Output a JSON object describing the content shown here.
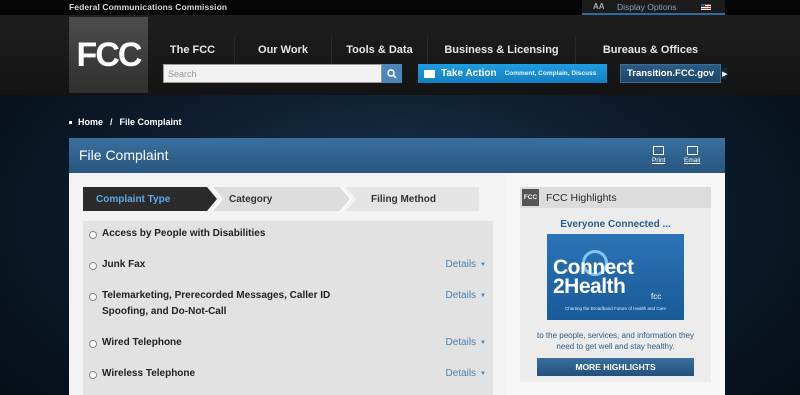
{
  "topbar": {
    "agency": "Federal Communications Commission",
    "aa": "AA",
    "display_options": "Display Options"
  },
  "logo": {
    "text": "FCC"
  },
  "nav": {
    "items": [
      {
        "label": "The FCC"
      },
      {
        "label": "Our Work"
      },
      {
        "label": "Tools & Data"
      },
      {
        "label": "Business & Licensing"
      },
      {
        "label": "Bureaus & Offices"
      }
    ]
  },
  "search": {
    "placeholder": "Search"
  },
  "take_action": {
    "label": "Take Action",
    "sub": "Comment, Complain, Discuss"
  },
  "transition": {
    "label": "Transition.FCC.gov",
    "arrow": "▶"
  },
  "breadcrumb": {
    "home": "Home",
    "separator": "/",
    "current": "File Complaint"
  },
  "panel": {
    "title": "File Complaint",
    "print": "Print",
    "email": "Email"
  },
  "steps": [
    {
      "label": "Complaint Type",
      "active": true
    },
    {
      "label": "Category",
      "active": false
    },
    {
      "label": "Filing Method",
      "active": false
    }
  ],
  "options": [
    {
      "label": "Access by People with Disabilities",
      "details": ""
    },
    {
      "label": "Junk Fax",
      "details": "Details"
    },
    {
      "label": "Telemarketing, Prerecorded Messages, Caller ID Spoofing, and Do-Not-Call",
      "details": "Details"
    },
    {
      "label": "Wired Telephone",
      "details": "Details"
    },
    {
      "label": "Wireless Telephone",
      "details": "Details"
    }
  ],
  "highlights": {
    "mini_logo": "FCC",
    "title": "FCC Highlights",
    "subtitle": "Everyone Connected ...",
    "image": {
      "line1": "Connect",
      "line2": "2Health",
      "suffix": "fcc",
      "tagline": "Charting the Broadband Future of Health and Care"
    },
    "text": "to the people, services, and information they need to get well and stay healthy.",
    "button": "MORE HIGHLIGHTS"
  },
  "colors": {
    "accent": "#2b73b6",
    "link": "#4a7fb0",
    "take_action": "#1f9de0",
    "active_step_text": "#5fa9e6"
  }
}
